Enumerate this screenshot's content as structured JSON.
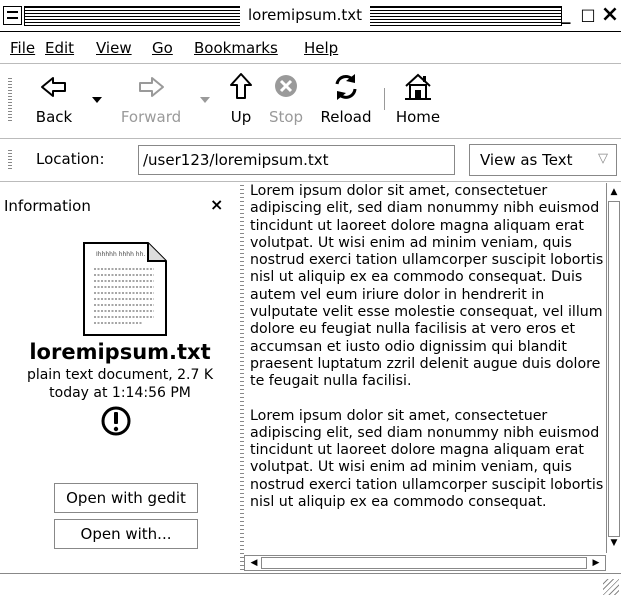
{
  "window": {
    "title": "loremipsum.txt",
    "controls": {
      "minimize": "_",
      "maximize": "□",
      "close": "×"
    }
  },
  "menubar": {
    "items": [
      {
        "label": "File",
        "mnemonic": "F"
      },
      {
        "label": "Edit",
        "mnemonic": "E"
      },
      {
        "label": "View",
        "mnemonic": "V"
      },
      {
        "label": "Go",
        "mnemonic": "G"
      },
      {
        "label": "Bookmarks",
        "mnemonic": "B"
      },
      {
        "label": "Help",
        "mnemonic": "H"
      }
    ]
  },
  "toolbar": {
    "back": "Back",
    "forward": "Forward",
    "up": "Up",
    "stop": "Stop",
    "reload": "Reload",
    "home": "Home"
  },
  "location": {
    "label": "Location:",
    "value": "/user123/loremipsum.txt",
    "view_as": "View as Text"
  },
  "sidebar": {
    "title": "Information",
    "close": "×",
    "file_name": "loremipsum.txt",
    "file_type": "plain text document, 2.7 K",
    "file_date": "today at 1:14:56 PM",
    "open_with_gedit": "Open with gedit",
    "open_with": "Open with..."
  },
  "content": {
    "paragraphs": [
      "Lorem ipsum dolor sit amet, consectetuer adipiscing elit, sed diam nonummy nibh euismod tincidunt ut laoreet dolore magna aliquam erat volutpat. Ut wisi enim ad minim veniam, quis nostrud exerci tation ullamcorper suscipit lobortis nisl ut aliquip ex ea commodo consequat. Duis autem vel eum iriure dolor in hendrerit in vulputate velit esse molestie consequat, vel illum dolore eu feugiat nulla facilisis at vero eros et accumsan et iusto odio dignissim qui blandit praesent luptatum zzril delenit augue duis dolore te feugait nulla facilisi.",
      "Lorem ipsum dolor sit amet, consectetuer adipiscing elit, sed diam nonummy nibh euismod tincidunt ut laoreet dolore magna aliquam erat volutpat. Ut wisi enim ad minim veniam, quis nostrud exerci tation ullamcorper suscipit lobortis nisl ut aliquip ex ea commodo consequat."
    ]
  },
  "icons": {
    "back": "back-arrow-icon",
    "forward": "forward-arrow-icon",
    "up": "up-arrow-icon",
    "stop": "stop-icon",
    "reload": "reload-icon",
    "home": "home-icon",
    "document": "text-document-icon",
    "warning": "warning-icon"
  }
}
